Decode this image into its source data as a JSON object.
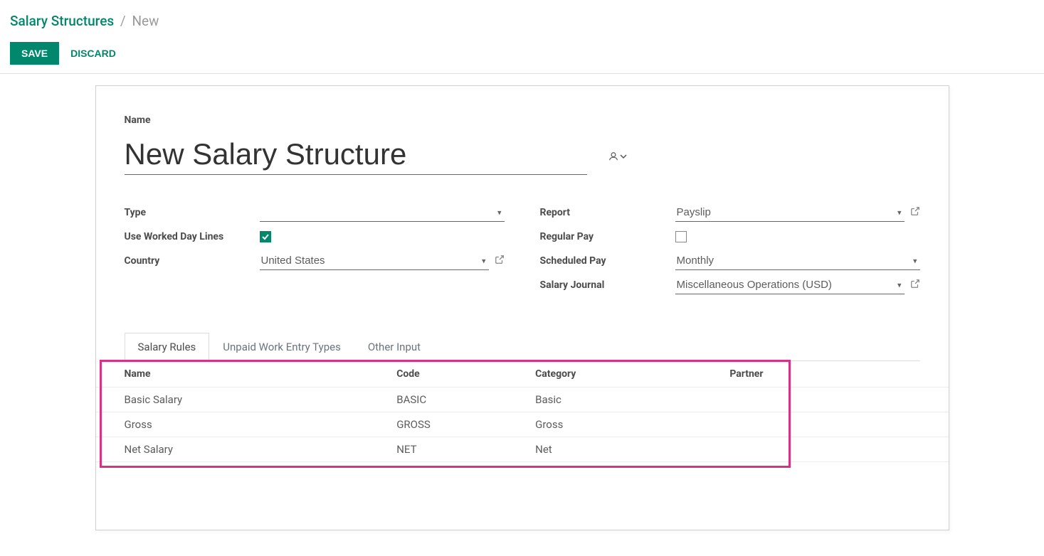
{
  "breadcrumb": {
    "root": "Salary Structures",
    "separator": "/",
    "current": "New"
  },
  "actions": {
    "save": "SAVE",
    "discard": "DISCARD"
  },
  "form": {
    "name_label": "Name",
    "name_value": "New Salary Structure",
    "left": {
      "type": {
        "label": "Type",
        "value": ""
      },
      "use_worked_day_lines": {
        "label": "Use Worked Day Lines",
        "checked": true
      },
      "country": {
        "label": "Country",
        "value": "United States"
      }
    },
    "right": {
      "report": {
        "label": "Report",
        "value": "Payslip"
      },
      "regular_pay": {
        "label": "Regular Pay",
        "checked": false
      },
      "scheduled_pay": {
        "label": "Scheduled Pay",
        "value": "Monthly"
      },
      "salary_journal": {
        "label": "Salary Journal",
        "value": "Miscellaneous Operations (USD)"
      }
    }
  },
  "tabs": [
    {
      "label": "Salary Rules",
      "active": true
    },
    {
      "label": "Unpaid Work Entry Types",
      "active": false
    },
    {
      "label": "Other Input",
      "active": false
    }
  ],
  "table": {
    "headers": {
      "name": "Name",
      "code": "Code",
      "category": "Category",
      "partner": "Partner"
    },
    "rows": [
      {
        "name": "Basic Salary",
        "code": "BASIC",
        "category": "Basic",
        "partner": ""
      },
      {
        "name": "Gross",
        "code": "GROSS",
        "category": "Gross",
        "partner": ""
      },
      {
        "name": "Net Salary",
        "code": "NET",
        "category": "Net",
        "partner": ""
      }
    ]
  }
}
